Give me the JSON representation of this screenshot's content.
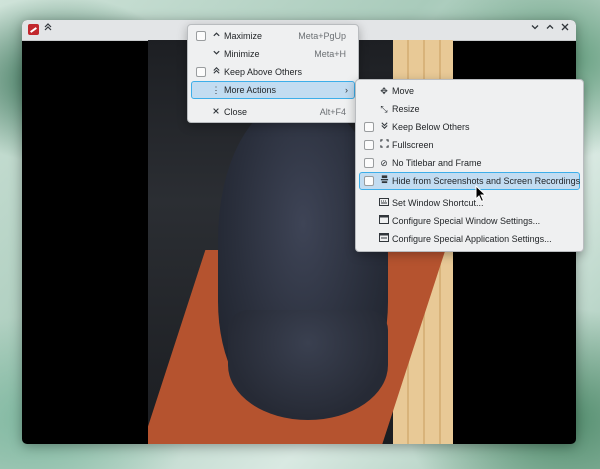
{
  "window": {
    "title_buttons": {
      "keep_above": "⌃",
      "minimize": "⌄",
      "maximize": "⌃",
      "close": "✕"
    }
  },
  "main_menu": {
    "items": [
      {
        "label": "Maximize",
        "shortcut": "Meta+PgUp",
        "icon": "chevron-up-icon"
      },
      {
        "label": "Minimize",
        "shortcut": "Meta+H",
        "icon": "chevron-down-icon"
      },
      {
        "label": "Keep Above Others",
        "shortcut": "",
        "icon": "double-chevron-up-icon"
      },
      {
        "label": "More Actions",
        "shortcut": "",
        "icon": "more-vertical-icon",
        "highlighted": true
      },
      {
        "label": "Close",
        "shortcut": "Alt+F4",
        "icon": "close-icon"
      }
    ]
  },
  "sub_menu": {
    "items": [
      {
        "label": "Move",
        "icon": "move-icon"
      },
      {
        "label": "Resize",
        "icon": "resize-icon"
      },
      {
        "label": "Keep Below Others",
        "icon": "double-chevron-down-icon",
        "checkbox": true
      },
      {
        "label": "Fullscreen",
        "icon": "fullscreen-icon",
        "checkbox": true
      },
      {
        "label": "No Titlebar and Frame",
        "icon": "no-icon",
        "checkbox": true
      },
      {
        "label": "Hide from Screenshots and Screen Recordings",
        "icon": "privacy-icon",
        "checkbox": true,
        "highlighted": true
      },
      {
        "label": "Set Window Shortcut...",
        "icon": "keyboard-icon"
      },
      {
        "label": "Configure Special Window Settings...",
        "icon": "window-settings-icon"
      },
      {
        "label": "Configure Special Application Settings...",
        "icon": "app-settings-icon"
      }
    ]
  },
  "colors": {
    "highlight_bg": "#c2dcf1",
    "highlight_border": "#3daee9",
    "menu_bg": "#eff0f1"
  }
}
